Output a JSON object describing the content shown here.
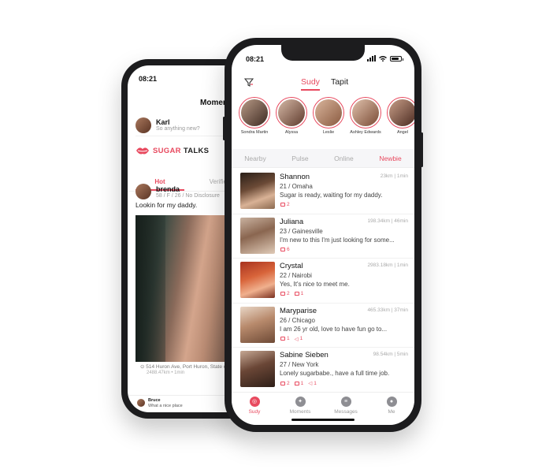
{
  "colors": {
    "accent": "#e84a5f",
    "muted": "#aaaaaa"
  },
  "back_phone": {
    "time": "08:21",
    "title": "Moment",
    "featured_user": {
      "name": "Karl",
      "preview": "So anything new?"
    },
    "brand": {
      "part1": "SUGAR",
      "part2": "TALKS"
    },
    "tabs": [
      {
        "label": "Hot",
        "active": true
      },
      {
        "label": "Verified",
        "active": false
      }
    ],
    "post": {
      "author": "brenda",
      "meta": "58 / F / 26 / No Disclosure",
      "text": "Lookin for my daddy.",
      "location": "514 Huron Ave, Port Huron, State of M",
      "distance": "2488.47km • 1min"
    },
    "comment": {
      "author": "Bruce",
      "text": "What a nice place"
    }
  },
  "front_phone": {
    "time": "08:21",
    "top_tabs": [
      {
        "label": "Sudy",
        "active": true
      },
      {
        "label": "Tapit",
        "active": false
      }
    ],
    "stories": [
      {
        "name": "Sondra Martin"
      },
      {
        "name": "Alyssa"
      },
      {
        "name": "Leslie"
      },
      {
        "name": "Ashley Edwards"
      },
      {
        "name": "Angel"
      }
    ],
    "filter_tabs": [
      {
        "label": "Nearby",
        "active": false
      },
      {
        "label": "Pulse",
        "active": false
      },
      {
        "label": "Online",
        "active": false
      },
      {
        "label": "Newbie",
        "active": true
      }
    ],
    "users": [
      {
        "name": "Shannon",
        "meta": "23km | 1min",
        "loc": "21 / Omaha",
        "msg": "Sugar is ready, waiting for my daddy.",
        "photos": "2",
        "comments": "",
        "likes": ""
      },
      {
        "name": "Juliana",
        "meta": "198.34km | 46min",
        "loc": "23 / Gainesville",
        "msg": "I'm new to this I'm just looking for some...",
        "photos": "6",
        "comments": "",
        "likes": ""
      },
      {
        "name": "Crystal",
        "meta": "2983.18km | 1min",
        "loc": "22 / Nairobi",
        "msg": "Yes, It's nice to meet me.",
        "photos": "2",
        "comments": "1",
        "likes": ""
      },
      {
        "name": "Maryparise",
        "meta": "465.33km | 37min",
        "loc": "26 / Chicago",
        "msg": "I am 26 yr old, love to have fun go to...",
        "photos": "1",
        "comments": "",
        "likes": "1"
      },
      {
        "name": "Sabine Sieben",
        "meta": "98.54km | 5min",
        "loc": "27 / New York",
        "msg": "Lonely sugarbabe., have a full time job.",
        "photos": "2",
        "comments": "1",
        "likes": "1"
      }
    ],
    "nav": [
      {
        "label": "Sudy",
        "icon": "target-icon",
        "active": true
      },
      {
        "label": "Moments",
        "icon": "compass-icon",
        "active": false
      },
      {
        "label": "Messages",
        "icon": "chat-icon",
        "active": false
      },
      {
        "label": "Me",
        "icon": "person-icon",
        "active": false
      }
    ]
  }
}
